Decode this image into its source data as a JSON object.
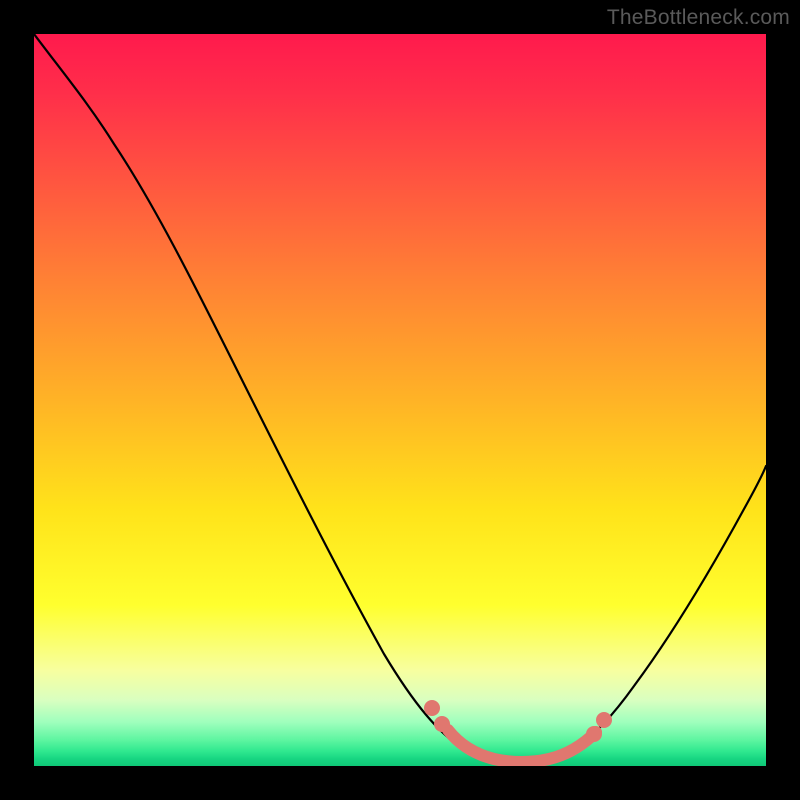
{
  "watermark": "TheBottleneck.com",
  "colors": {
    "background": "#000000",
    "gradient_top": "#ff1a4d",
    "gradient_bottom": "#0fc877",
    "curve": "#000000",
    "highlight": "#e0776f"
  },
  "chart_data": {
    "type": "line",
    "title": "",
    "xlabel": "",
    "ylabel": "",
    "xlim": [
      0,
      100
    ],
    "ylim": [
      0,
      100
    ],
    "x": [
      0,
      4,
      8,
      12,
      16,
      20,
      24,
      28,
      32,
      36,
      40,
      44,
      48,
      52,
      56,
      58,
      60,
      62,
      64,
      66,
      68,
      70,
      72,
      74,
      78,
      82,
      86,
      90,
      94,
      98,
      100
    ],
    "values": [
      100,
      98,
      95,
      91,
      86,
      80,
      73,
      66,
      58,
      50,
      42,
      34,
      26,
      19,
      12,
      9,
      6,
      4,
      2.5,
      1.5,
      1,
      1,
      1.5,
      2.5,
      6,
      12,
      20,
      29,
      38,
      46,
      50
    ],
    "highlight_segment": {
      "x": [
        54,
        56,
        58,
        60,
        62,
        64,
        66,
        68,
        70,
        72,
        74,
        76
      ],
      "values": [
        14,
        12,
        9,
        6,
        4,
        2.5,
        1.5,
        1,
        1,
        1.5,
        2.5,
        5
      ]
    },
    "highlight_dots": [
      {
        "x": 54,
        "y": 14
      },
      {
        "x": 56,
        "y": 10
      },
      {
        "x": 76,
        "y": 5
      },
      {
        "x": 77,
        "y": 8
      }
    ]
  }
}
